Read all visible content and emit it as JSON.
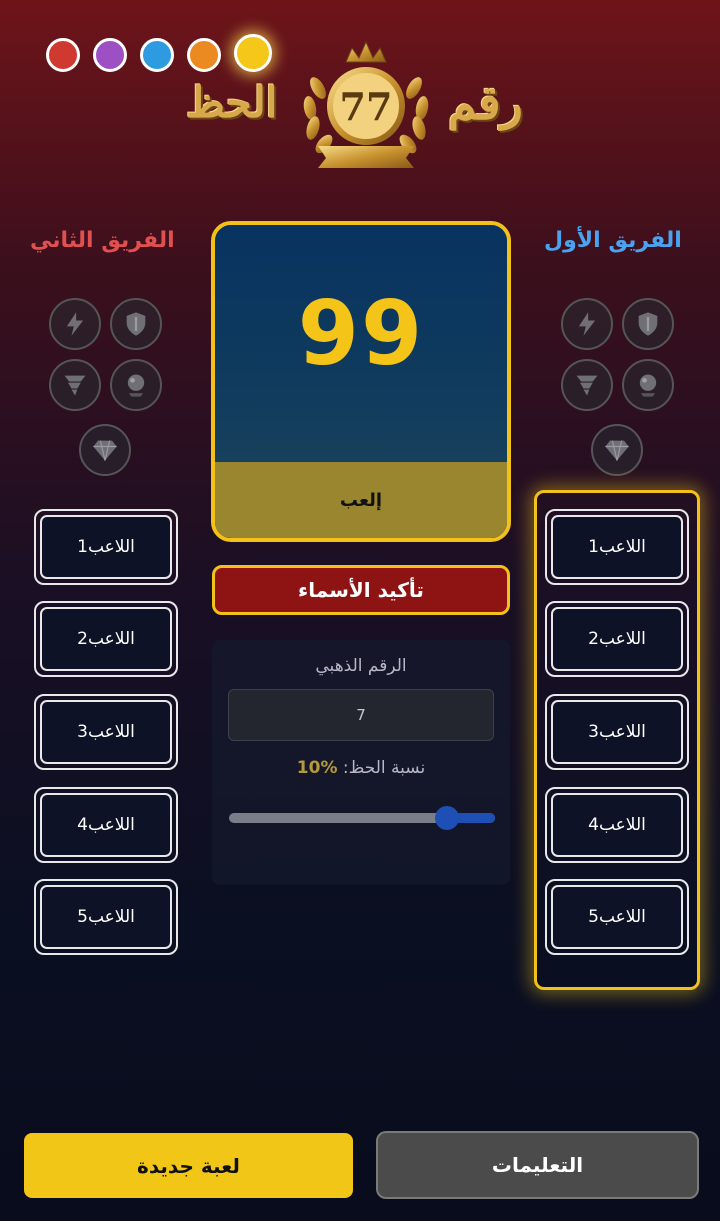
{
  "logo": {
    "word_left": "الحظ",
    "word_right": "رقم",
    "emblem_number": "77"
  },
  "colors": {
    "dots": [
      "#d0392f",
      "#9c50c4",
      "#2e9be0",
      "#ec8a22",
      "#f5c718"
    ],
    "selected_dot_index": 4,
    "accent": "#f2c21a",
    "team1": "#4aa3f0",
    "team2": "#e05050"
  },
  "teams": {
    "team2": {
      "title": "الفريق الثاني",
      "powers": [
        "lightning-icon",
        "shield-icon",
        "tornado-icon",
        "crystal-ball-icon",
        "diamond-icon"
      ],
      "players": [
        "اللاعب1",
        "اللاعب2",
        "اللاعب3",
        "اللاعب4",
        "اللاعب5"
      ]
    },
    "team1": {
      "title": "الفريق الأول",
      "powers": [
        "lightning-icon",
        "shield-icon",
        "tornado-icon",
        "crystal-ball-icon",
        "diamond-icon"
      ],
      "players": [
        "اللاعب1",
        "اللاعب2",
        "اللاعب3",
        "اللاعب4",
        "اللاعب5"
      ],
      "active": true
    }
  },
  "card": {
    "number": "99",
    "play_label": "إلعب"
  },
  "confirm_label": "تأكيد الأسماء",
  "settings": {
    "golden_label": "الرقم الذهبي",
    "golden_value": "7",
    "luck_label": "نسبة الحظ:",
    "luck_value": "%10",
    "luck_slider_fraction": 0.82
  },
  "buttons": {
    "new_game": "لعبة جديدة",
    "instructions": "التعليمات"
  }
}
